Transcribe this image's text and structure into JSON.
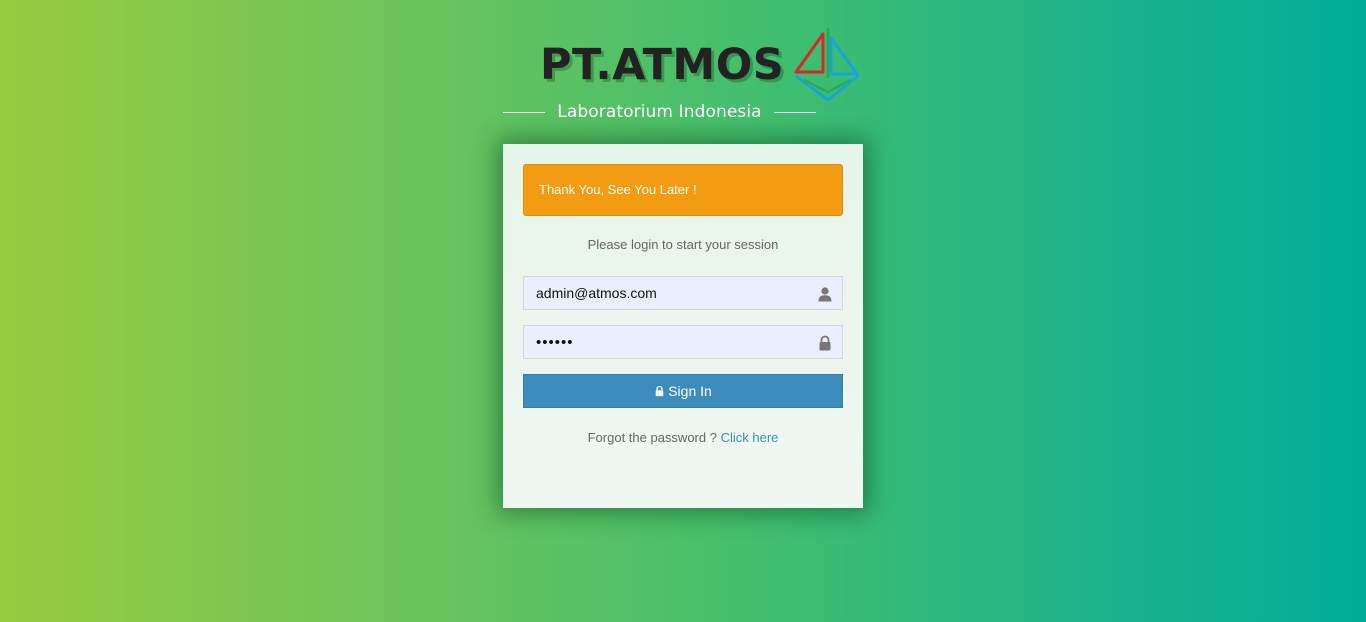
{
  "brand": {
    "title": "PT.ATMOS",
    "subtitle": "Laboratorium Indonesia",
    "logo_icon": "atmos-sail-logo"
  },
  "alert": {
    "message": "Thank You, See You Later !",
    "color": "#f39c12"
  },
  "login": {
    "message": "Please login to start your session",
    "email": {
      "value": "admin@atmos.com",
      "icon": "user-icon"
    },
    "password": {
      "value": "••••••",
      "icon": "lock-icon"
    },
    "signin_label": "Sign In",
    "signin_icon": "lock-icon",
    "forgot_text": "Forgot the password ?",
    "forgot_link": "Click here",
    "accent_color": "#3c8dbc"
  }
}
